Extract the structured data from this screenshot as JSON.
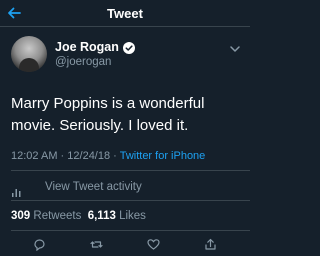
{
  "header": {
    "title": "Tweet"
  },
  "icons": {
    "back": "arrow-left-icon",
    "verified": "verified-badge-icon",
    "more": "chevron-down-icon",
    "activity": "bar-chart-icon",
    "reply": "reply-icon",
    "retweet": "retweet-icon",
    "like": "heart-icon",
    "share": "share-icon"
  },
  "colors": {
    "background": "#15202b",
    "accent": "#1da1f2",
    "secondary_text": "#8899a6"
  },
  "tweet": {
    "display_name": "Joe Rogan",
    "handle": "@joerogan",
    "text": "Marry Poppins is a wonderful movie. Seriously. I loved it.",
    "time": "12:02 AM",
    "date": "12/24/18",
    "separator": "·",
    "via": "Twitter for iPhone"
  },
  "activity": {
    "label": "View Tweet activity"
  },
  "stats": {
    "retweets_count": "309",
    "retweets_label": "Retweets",
    "likes_count": "6,113",
    "likes_label": "Likes"
  }
}
